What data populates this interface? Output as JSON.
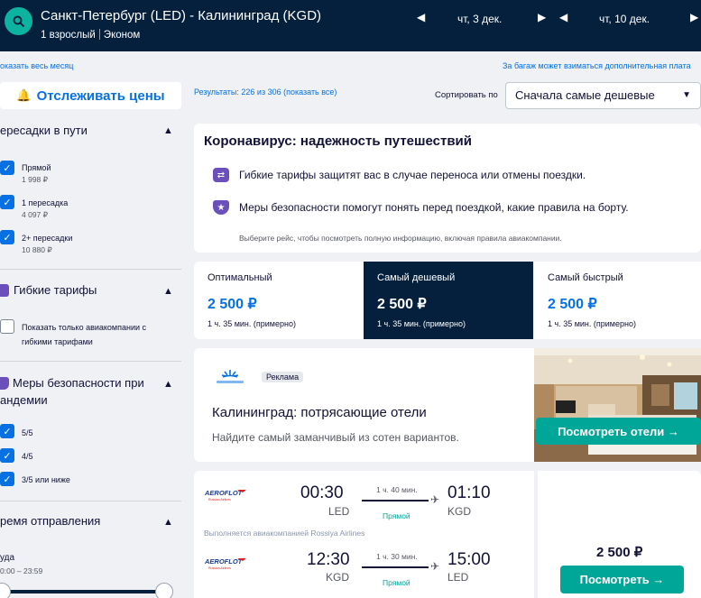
{
  "header": {
    "route": "Санкт-Петербург (LED) - Калининград (KGD)",
    "passengers": "1 взрослый",
    "cabin": "Эконом",
    "depart_date": "чт, 3 дек.",
    "return_date": "чт, 10 дек."
  },
  "links": {
    "show_month": "оказать весь месяц",
    "baggage_note": "За багаж может взиматься дополнительная плата"
  },
  "track_prices_label": "Отслеживать цены",
  "results_summary": "Результаты: 226 из 306 (показать все)",
  "sort": {
    "label": "Сортировать по",
    "selected": "Сначала самые дешевые"
  },
  "sidebar": {
    "stops": {
      "title": "ересадки в пути",
      "options": [
        {
          "label": "Прямой",
          "price": "1 998 ₽",
          "checked": true
        },
        {
          "label": "1 пересадка",
          "price": "4 097 ₽",
          "checked": true
        },
        {
          "label": "2+ пересадки",
          "price": "10 880 ₽",
          "checked": true
        }
      ]
    },
    "flex": {
      "title": "Гибкие тарифы",
      "option_line1": "Показать только авиакомпании с",
      "option_line2": "гибкими тарифами"
    },
    "safety": {
      "title_line1": "Меры безопасности при",
      "title_line2": "андемии",
      "options": [
        "5/5",
        "4/5",
        "3/5 или ниже"
      ]
    },
    "departure": {
      "title": "ремя отправления",
      "sub_label": "уда",
      "range": "0:00 – 23:59"
    }
  },
  "covid": {
    "title": "Коронавирус: надежность путешествий",
    "line1": "Гибкие тарифы защитят вас в случае переноса или отмены поездки.",
    "line2": "Меры безопасности помогут понять перед поездкой, какие правила на борту.",
    "note": "Выберите рейс, чтобы посмотреть полную информацию, включая правила авиакомпании."
  },
  "tabs": [
    {
      "title": "Оптимальный",
      "price": "2 500 ₽",
      "duration": "1 ч. 35 мин. (примерно)"
    },
    {
      "title": "Самый дешевый",
      "price": "2 500 ₽",
      "duration": "1 ч. 35 мин. (примерно)"
    },
    {
      "title": "Самый быстрый",
      "price": "2 500 ₽",
      "duration": "1 ч. 35 мин. (примерно)"
    }
  ],
  "ad": {
    "brand": "Skyscanner",
    "badge": "Реклама",
    "title": "Калининград: потрясающие отели",
    "subtitle": "Найдите самый заманчивый из сотен вариантов.",
    "button": "Посмотреть отели →"
  },
  "flights": [
    {
      "dep_time": "00:30",
      "dep_iata": "LED",
      "duration": "1 ч. 40 мин.",
      "stops": "Прямой",
      "arr_time": "01:10",
      "arr_iata": "KGD",
      "operated": "Выполняется авиакомпанией Rossiya Airlines"
    },
    {
      "dep_time": "12:30",
      "dep_iata": "KGD",
      "duration": "1 ч. 30 мин.",
      "stops": "Прямой",
      "arr_time": "15:00",
      "arr_iata": "LED"
    }
  ],
  "offer": {
    "price": "2 500 ₽",
    "button": "Посмотреть →"
  },
  "colors": {
    "header_bg": "#05203c",
    "accent_blue": "#0770e3",
    "accent_green": "#00a698",
    "selected_tab_bg": "#05203c",
    "flex_icon": "#6b4fbb"
  },
  "icons": [
    "search-icon",
    "bell-icon",
    "chevron-left-icon",
    "chevron-right-icon",
    "chevron-up-icon",
    "caret-down-icon",
    "checkmark-icon",
    "flexible-ticket-icon",
    "shield-icon",
    "plane-icon",
    "arrow-right-icon"
  ]
}
